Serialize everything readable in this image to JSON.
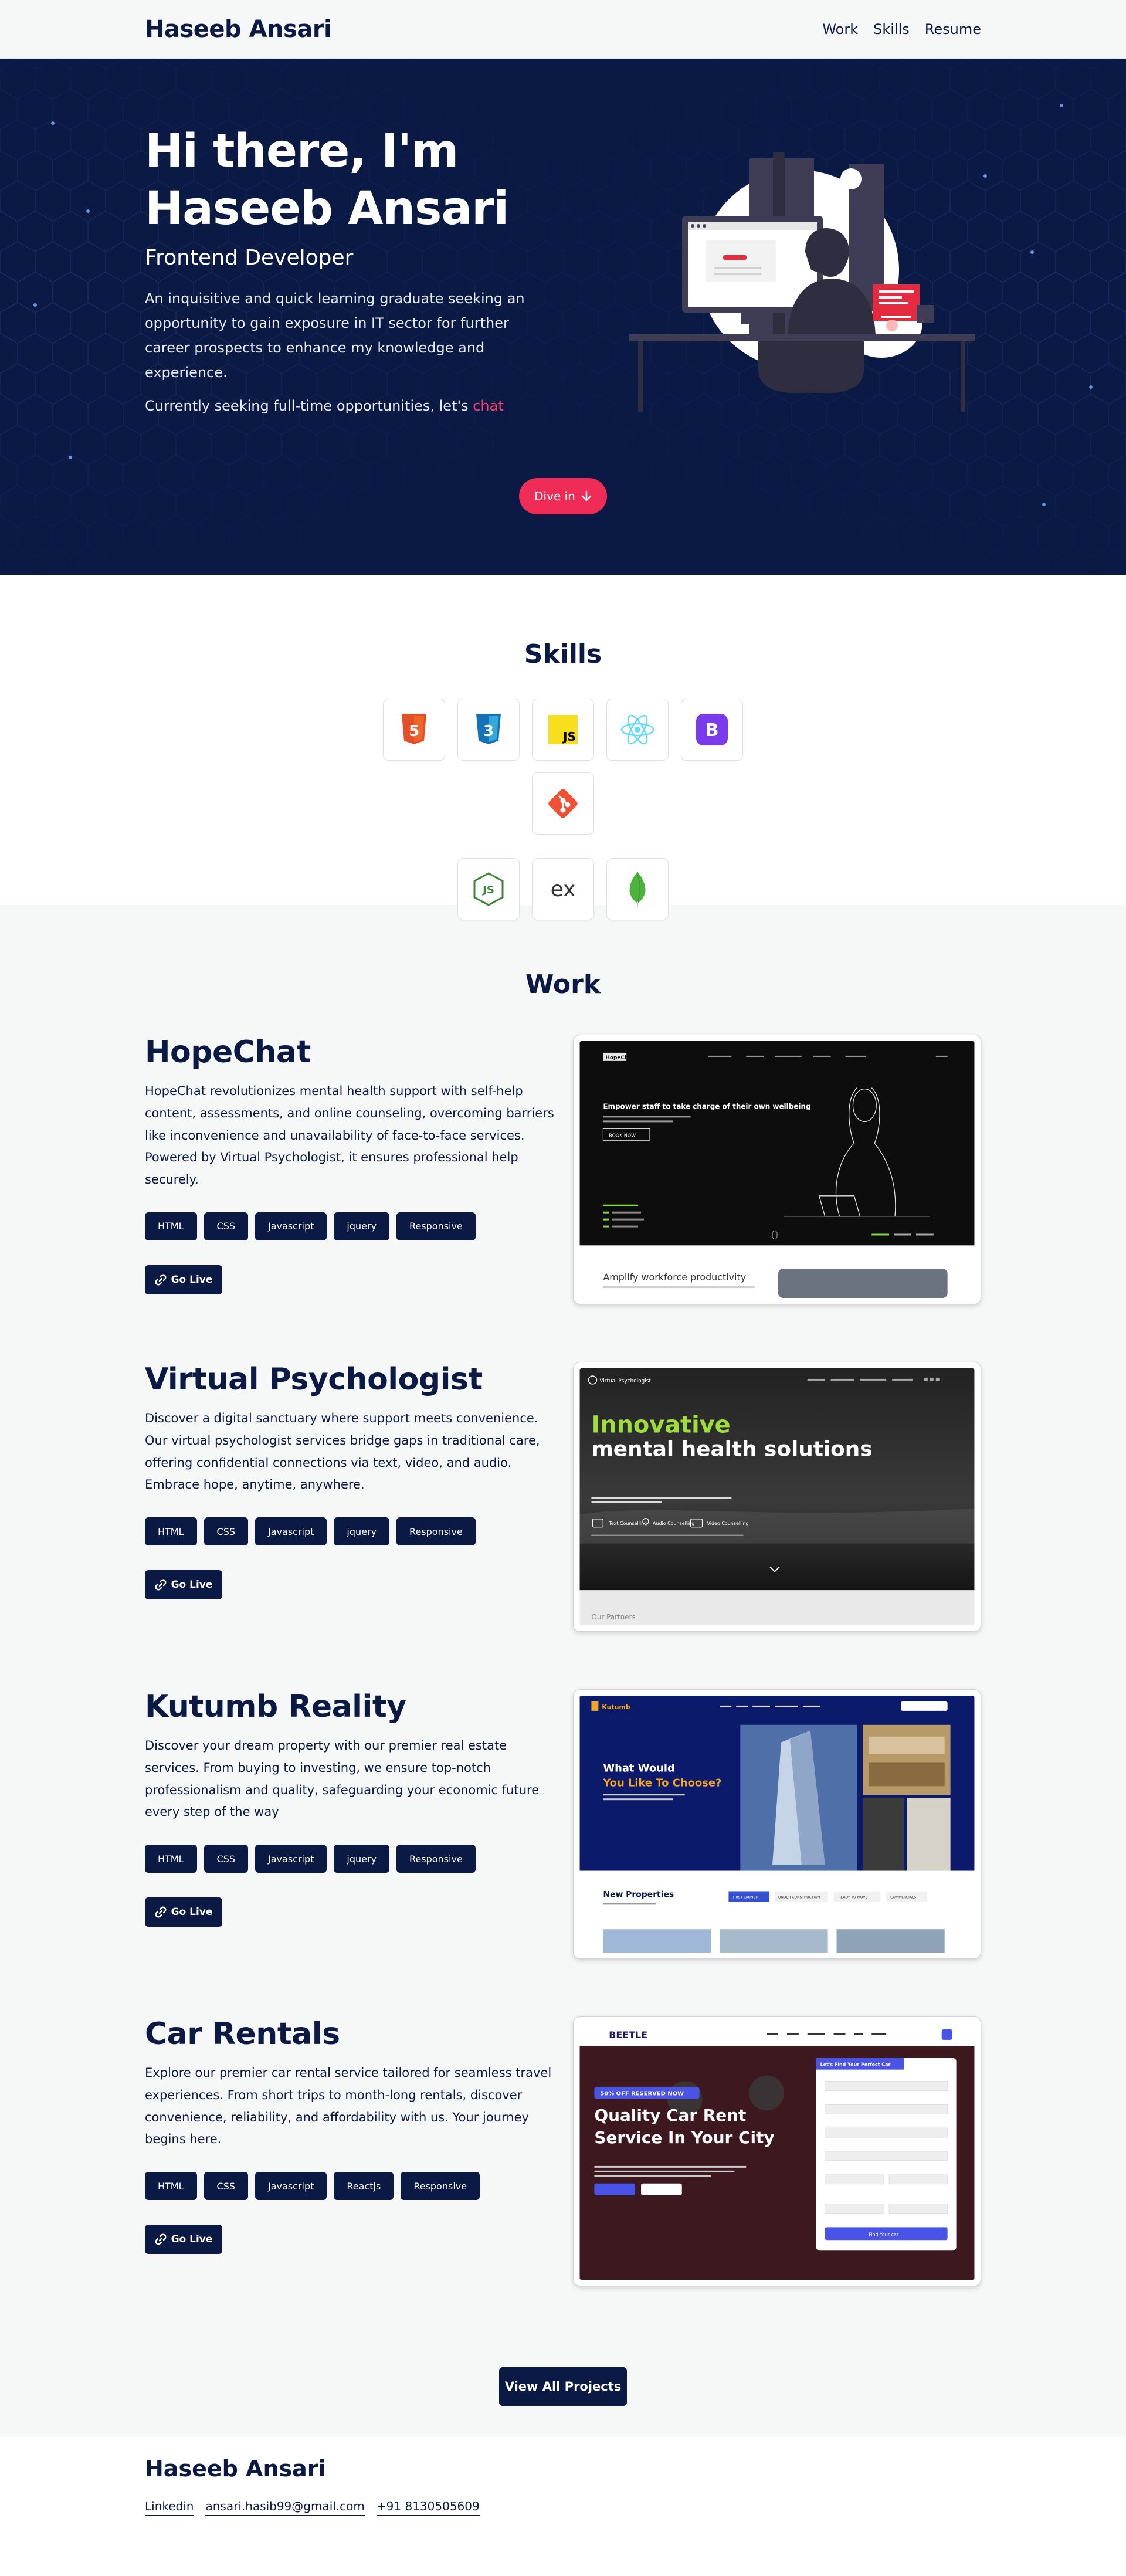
{
  "header": {
    "brand": "Haseeb Ansari",
    "nav": [
      "Work",
      "Skills",
      "Resume"
    ]
  },
  "hero": {
    "title": "Hi there, I'm Haseeb Ansari",
    "role": "Frontend Developer",
    "description": "An inquisitive and quick learning graduate seeking an opportunity to gain exposure in IT sector for further career prospects to enhance my knowledge and experience.",
    "seeking_prefix": "Currently seeking full-time opportunities, let's ",
    "seeking_link": "chat",
    "dive_button": "Dive in",
    "illustration_icon": "developer-at-desk-illustration"
  },
  "skills": {
    "title": "Skills",
    "items": [
      {
        "name": "html5-icon",
        "color": "#e34f26",
        "label": "5"
      },
      {
        "name": "css3-icon",
        "color": "#1572b6",
        "label": "3"
      },
      {
        "name": "javascript-icon",
        "color": "#f7df1e",
        "label": "JS"
      },
      {
        "name": "react-icon",
        "color": "#61dafb",
        "label": ""
      },
      {
        "name": "bootstrap-icon",
        "color": "#7c3aed",
        "label": "B"
      },
      {
        "name": "git-icon",
        "color": "#f05033",
        "label": ""
      },
      {
        "name": "nodejs-icon",
        "color": "#3c873a",
        "label": "JS"
      },
      {
        "name": "express-icon",
        "color": "#333333",
        "label": "ex"
      },
      {
        "name": "mongodb-icon",
        "color": "#4db33d",
        "label": ""
      }
    ]
  },
  "work": {
    "title": "Work",
    "projects": [
      {
        "title": "HopeChat",
        "description": "HopeChat revolutionizes mental health support with self-help content, assessments, and online counseling, overcoming barriers like inconvenience and unavailability of face-to-face services. Powered by Virtual Psychologist, it ensures professional help securely.",
        "tags": [
          "HTML",
          "CSS",
          "Javascript",
          "jquery",
          "Responsive"
        ],
        "go_live": "Go Live",
        "shot": {
          "logo": "HopeChat",
          "headline": "Empower staff to take charge of their own wellbeing",
          "cta": "BOOK NOW",
          "footer": "Amplify workforce productivity"
        }
      },
      {
        "title": "Virtual Psychologist",
        "description": "Discover a digital sanctuary where support meets convenience. Our virtual psychologist services bridge gaps in traditional care, offering confidential connections via text, video, and audio. Embrace hope, anytime, anywhere.",
        "tags": [
          "HTML",
          "CSS",
          "Javascript",
          "jquery",
          "Responsive"
        ],
        "go_live": "Go Live",
        "shot": {
          "logo": "Virtual Psychologist",
          "headline_green": "Innovative",
          "headline_white": "mental health solutions",
          "features": [
            "Text Counselling",
            "Audio Counselling",
            "Video Counselling"
          ],
          "footer": "Our Partners"
        }
      },
      {
        "title": "Kutumb Reality",
        "description": "Discover your dream property with our premier real estate services. From buying to investing, we ensure top-notch professionalism and quality, safeguarding your economic future every step of the way",
        "tags": [
          "HTML",
          "CSS",
          "Javascript",
          "jquery",
          "Responsive"
        ],
        "go_live": "Go Live",
        "shot": {
          "logo": "Kutumb",
          "headline_white": "What Would",
          "headline_orange": "You Like To Choose?",
          "section": "New Properties",
          "filters": [
            "FIRST LAUNCH",
            "UNDER CONSTRUCTION",
            "READY TO MOVE",
            "COMMERCIALS"
          ]
        }
      },
      {
        "title": "Car Rentals",
        "description": "Explore our premier car rental service tailored for seamless travel experiences. From short trips to month-long rentals, discover convenience, reliability, and affordability with us. Your journey begins here.",
        "tags": [
          "HTML",
          "CSS",
          "Javascript",
          "Reactjs",
          "Responsive"
        ],
        "go_live": "Go Live",
        "shot": {
          "logo": "BEETLE",
          "badge": "50% OFF RESERVED NOW",
          "headline": "Quality Car Rent Service In Your City",
          "form_title": "Let's Find Your Perfect Car",
          "form_button": "Find Your car"
        }
      }
    ],
    "view_all": "View All Projects"
  },
  "footer": {
    "brand": "Haseeb Ansari",
    "links": [
      "Linkedin",
      "ansari.hasib99@gmail.com",
      "+91 8130505609"
    ]
  },
  "colors": {
    "navy": "#0b1a44",
    "accent": "#ef2c56",
    "light_bg": "#f6f7f7"
  }
}
